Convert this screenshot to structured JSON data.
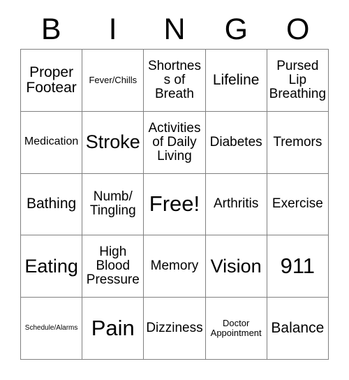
{
  "card": {
    "title": "BINGO",
    "headers": [
      "B",
      "I",
      "N",
      "G",
      "O"
    ],
    "rows": [
      [
        {
          "label": "Proper Footear",
          "size": "lg"
        },
        {
          "label": "Fever/Chills",
          "size": "xs"
        },
        {
          "label": "Shortness of Breath",
          "size": "md"
        },
        {
          "label": "Lifeline",
          "size": "lg"
        },
        {
          "label": "Pursed Lip Breathing",
          "size": "md"
        }
      ],
      [
        {
          "label": "Medication",
          "size": "sm"
        },
        {
          "label": "Stroke",
          "size": "xl"
        },
        {
          "label": "Activities of Daily Living",
          "size": "md"
        },
        {
          "label": "Diabetes",
          "size": "md"
        },
        {
          "label": "Tremors",
          "size": "md"
        }
      ],
      [
        {
          "label": "Bathing",
          "size": "lg"
        },
        {
          "label": "Numb/ Tingling",
          "size": "md"
        },
        {
          "label": "Free!",
          "size": "xxl"
        },
        {
          "label": "Arthritis",
          "size": "md"
        },
        {
          "label": "Exercise",
          "size": "md"
        }
      ],
      [
        {
          "label": "Eating",
          "size": "xl"
        },
        {
          "label": "High Blood Pressure",
          "size": "md"
        },
        {
          "label": "Memory",
          "size": "md"
        },
        {
          "label": "Vision",
          "size": "xl"
        },
        {
          "label": "911",
          "size": "xxl"
        }
      ],
      [
        {
          "label": "Schedule/Alarms",
          "size": "xxs"
        },
        {
          "label": "Pain",
          "size": "xxl"
        },
        {
          "label": "Dizziness",
          "size": "md"
        },
        {
          "label": "Doctor Appointment",
          "size": "xs"
        },
        {
          "label": "Balance",
          "size": "lg"
        }
      ]
    ]
  },
  "colors": {
    "border": "#808080",
    "background": "#ffffff",
    "text": "#000000"
  }
}
